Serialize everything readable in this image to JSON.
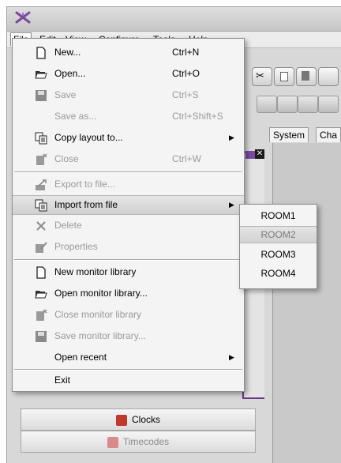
{
  "menubar": {
    "items": [
      {
        "label": "File"
      },
      {
        "label": "Edit"
      },
      {
        "label": "View"
      },
      {
        "label": "Configure"
      },
      {
        "label": "Tools"
      },
      {
        "label": "Help"
      }
    ]
  },
  "file_menu": {
    "items": [
      {
        "label": "New...",
        "shortcut": "Ctrl+N",
        "icon": "new-document-icon",
        "enabled": true
      },
      {
        "label": "Open...",
        "shortcut": "Ctrl+O",
        "icon": "open-folder-icon",
        "enabled": true
      },
      {
        "label": "Save",
        "shortcut": "Ctrl+S",
        "icon": "save-disk-icon",
        "enabled": false
      },
      {
        "label": "Save as...",
        "shortcut": "Ctrl+Shift+S",
        "icon": "",
        "enabled": false
      },
      {
        "label": "Copy layout to...",
        "shortcut": "",
        "icon": "copy-layout-icon",
        "enabled": true,
        "submenu": true
      },
      {
        "label": "Close",
        "shortcut": "Ctrl+W",
        "icon": "close-document-icon",
        "enabled": false
      },
      {
        "label": "Export to file...",
        "shortcut": "",
        "icon": "export-icon",
        "enabled": false
      },
      {
        "label": "Import from file",
        "shortcut": "",
        "icon": "import-icon",
        "enabled": true,
        "submenu": true
      },
      {
        "label": "Delete",
        "shortcut": "",
        "icon": "delete-x-icon",
        "enabled": false
      },
      {
        "label": "Properties",
        "shortcut": "",
        "icon": "properties-icon",
        "enabled": false
      },
      {
        "label": "New monitor library",
        "shortcut": "",
        "icon": "new-document-icon",
        "enabled": true
      },
      {
        "label": "Open monitor library...",
        "shortcut": "",
        "icon": "open-folder-icon",
        "enabled": true
      },
      {
        "label": "Close monitor library",
        "shortcut": "",
        "icon": "close-document-icon",
        "enabled": false
      },
      {
        "label": "Save monitor library...",
        "shortcut": "",
        "icon": "save-disk-icon",
        "enabled": false
      },
      {
        "label": "Open recent",
        "shortcut": "",
        "icon": "",
        "enabled": true,
        "submenu": true
      },
      {
        "label": "Exit",
        "shortcut": "",
        "icon": "",
        "enabled": true
      }
    ]
  },
  "import_submenu": {
    "items": [
      {
        "label": "ROOM1"
      },
      {
        "label": "ROOM2"
      },
      {
        "label": "ROOM3"
      },
      {
        "label": "ROOM4"
      }
    ]
  },
  "tabs": [
    {
      "label": "System"
    },
    {
      "label": "Cha"
    }
  ],
  "left_panel": {
    "buttons": [
      {
        "label": "Clocks",
        "enabled": true
      },
      {
        "label": "Timecodes",
        "enabled": false
      }
    ]
  },
  "colors": {
    "menu_background": "#f4f4f4",
    "highlight": "#d8d8d8",
    "disabled_text": "#9a9a9a",
    "panel_border": "#6c3a8c"
  }
}
